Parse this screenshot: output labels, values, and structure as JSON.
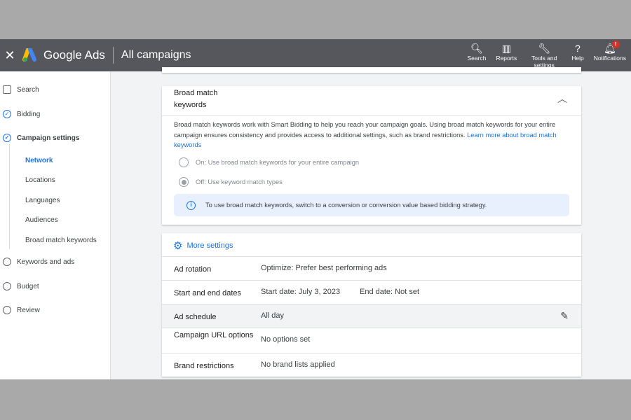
{
  "header": {
    "close_icon": "close-icon",
    "brand": "Google Ads",
    "title": "All campaigns",
    "tools": [
      {
        "icon": "search-icon",
        "glyph": "🔍︎",
        "label": "Search"
      },
      {
        "icon": "reports-icon",
        "glyph": "▥",
        "label": "Reports"
      },
      {
        "icon": "wrench-icon",
        "glyph": "🔧︎",
        "label": "Tools and settings"
      },
      {
        "icon": "help-icon",
        "glyph": "?",
        "label": "Help"
      },
      {
        "icon": "bell-icon",
        "glyph": "🔔︎",
        "label": "Notifications",
        "badge": "!"
      }
    ]
  },
  "sidebar": {
    "items": [
      {
        "label": "Search",
        "icon": "search-icon"
      },
      {
        "label": "Bidding",
        "icon": "check-circle-icon"
      },
      {
        "label": "Campaign settings",
        "icon": "check-circle-icon"
      },
      {
        "label": "Keywords and ads",
        "icon": "circle-icon"
      },
      {
        "label": "Budget",
        "icon": "circle-icon"
      },
      {
        "label": "Review",
        "icon": "circle-icon"
      }
    ],
    "subitems": [
      "Network",
      "Locations",
      "Languages",
      "Audiences",
      "Broad match keywords"
    ]
  },
  "broad_match": {
    "title": "Broad match keywords",
    "description": "Broad match keywords work with Smart Bidding to help you reach your campaign goals. Using broad match keywords for your entire campaign ensures consistency and provides access to additional settings, such as brand restrictions.",
    "link": "Learn more about broad match keywords",
    "options": [
      {
        "label": "On: Use broad match keywords for your entire campaign",
        "selected": false
      },
      {
        "label": "Off: Use keyword match types",
        "selected": true
      }
    ],
    "info": "To use broad match keywords, switch to a conversion or conversion value based bidding strategy."
  },
  "more_settings": {
    "title": "More settings",
    "rows": [
      {
        "key": "Ad rotation",
        "value": "Optimize: Prefer best performing ads"
      },
      {
        "key": "Start and end dates",
        "value": "Start date: July 3, 2023",
        "value2": "End date: Not set"
      },
      {
        "key": "Ad schedule",
        "value": "All day"
      },
      {
        "key": "Campaign URL options",
        "value": "No options set"
      },
      {
        "key": "Brand restrictions",
        "value": "No brand lists applied"
      }
    ]
  },
  "colors": {
    "accent": "#1a73e8",
    "header": "#55575c",
    "info_bg": "#e8f0fe"
  }
}
